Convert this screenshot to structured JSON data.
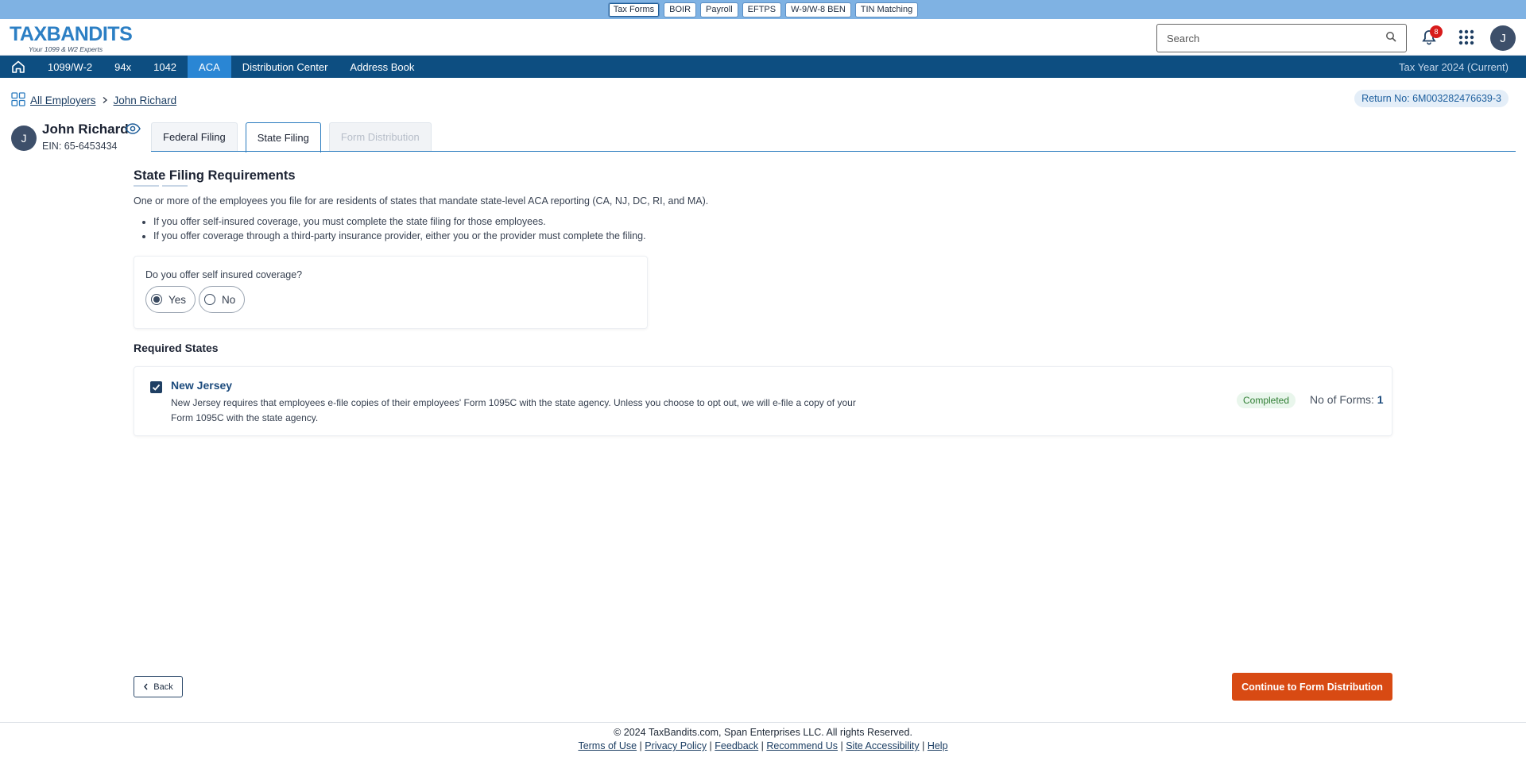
{
  "top_strip": {
    "items": [
      "Tax Forms",
      "BOIR",
      "Payroll",
      "EFTPS",
      "W-9/W-8 BEN",
      "TIN Matching"
    ]
  },
  "header": {
    "logo_text": "TAXBANDITS",
    "logo_tagline": "Your 1099 & W2 Experts",
    "search_placeholder": "Search",
    "notification_count": "8",
    "user_initial": "J"
  },
  "nav": {
    "items": [
      "1099/W-2",
      "94x",
      "1042",
      "ACA",
      "Distribution Center",
      "Address Book"
    ],
    "active": "ACA",
    "tax_year": "Tax Year 2024 (Current)"
  },
  "breadcrumb": {
    "root": "All Employers",
    "current": "John Richard"
  },
  "return_no": "Return No: 6M003282476639-3",
  "employer": {
    "initial": "J",
    "name": "John Richard",
    "ein": "EIN: 65-6453434"
  },
  "tabs": [
    "Federal Filing",
    "State Filing",
    "Form Distribution"
  ],
  "section": {
    "title": "State Filing Requirements",
    "intro": "One or more of the employees you file for are residents of states that mandate state-level ACA reporting (CA, NJ, DC, RI, and MA).",
    "bullets": [
      "If you offer self-insured coverage, you must complete the state filing for those employees.",
      "If you offer coverage through a third-party insurance provider, either you or the provider must complete the filing."
    ]
  },
  "question": {
    "label": "Do you offer self insured coverage?",
    "yes": "Yes",
    "no": "No",
    "selected": "Yes"
  },
  "required_states": {
    "title": "Required States",
    "items": [
      {
        "name": "New Jersey",
        "description": "New Jersey requires that employees e-file copies of their employees' Form 1095C with the state agency. Unless you choose to opt out, we will e-file a copy of your Form 1095C with the state agency.",
        "status": "Completed",
        "forms_label": "No of Forms:",
        "forms_count": "1",
        "checked": true
      }
    ]
  },
  "buttons": {
    "back": "Back",
    "continue": "Continue to Form Distribution"
  },
  "footer": {
    "copyright": "© 2024 TaxBandits.com, Span Enterprises LLC. All rights Reserved.",
    "links": [
      "Terms of Use",
      "Privacy Policy",
      "Feedback",
      "Recommend Us",
      "Site Accessibility",
      "Help"
    ]
  },
  "colors": {
    "nav_bg": "#0d4e81",
    "nav_active": "#2a86d4",
    "continue_btn": "#d84a13",
    "top_strip": "#7fb2e3"
  }
}
